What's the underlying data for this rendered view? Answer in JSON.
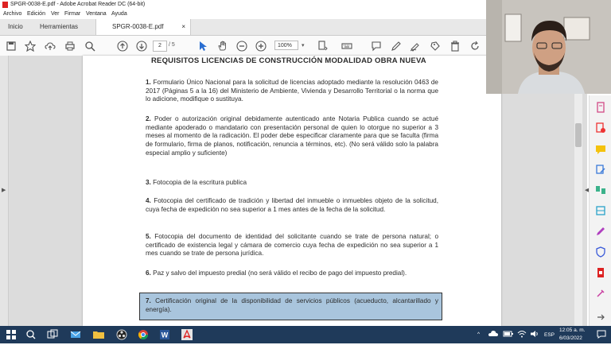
{
  "window": {
    "title": "SPGR-0038-E.pdf - Adobe Acrobat Reader DC (64-bit)"
  },
  "menu": [
    "Archivo",
    "Edición",
    "Ver",
    "Firmar",
    "Ventana",
    "Ayuda"
  ],
  "tabs": {
    "home": "Inicio",
    "tools": "Herramientas",
    "doc": "SPGR-0038-E.pdf",
    "close": "×"
  },
  "toolbar": {
    "page_current": "2",
    "page_total": "/ 5",
    "zoom": "100%",
    "zoom_caret": "▾"
  },
  "document": {
    "title": "REQUISITOS LICENCIAS DE CONSTRUCCIÓN MODALIDAD OBRA NUEVA",
    "items": [
      {
        "num": "1.",
        "text": "Formulario Único Nacional para la solicitud de licencias adoptado mediante la resolución 0463 de 2017 (Páginas 5 a la 16) del Ministerio de Ambiente, Vivienda y Desarrollo Territorial o la norma que lo adicione, modifique o sustituya."
      },
      {
        "num": "2.",
        "text": "Poder o autorización original debidamente autenticado ante Notaria Publica cuando se actué mediante apoderado o mandatario con presentación personal de quien lo otorgue no superior a 3 meses al momento de la radicación. El poder debe especificar claramente para que se faculta (firma de formulario, firma de planos, notificación, renuncia a términos, etc). (No será válido solo la palabra especial amplio y suficiente)"
      },
      {
        "num": "3.",
        "text": "Fotocopia de la escritura publica"
      },
      {
        "num": "4.",
        "text": "Fotocopia del certificado de tradición y libertad del inmueble o inmuebles objeto de la solicitud, cuya fecha de expedición no sea superior a 1 mes antes de la fecha de la solicitud."
      },
      {
        "num": "5.",
        "text": "Fotocopia del documento de identidad del solicitante cuando se trate de persona natural; o certificado de existencia legal y cámara de comercio cuya fecha de expedición no sea superior a 1 mes cuando se trate de persona jurídica."
      },
      {
        "num": "6.",
        "text": "Paz y salvo del impuesto predial (no será válido el recibo de pago del impuesto predial)."
      },
      {
        "num": "7.",
        "text": "Certificación original de la disponibilidad de servicios públicos (acueducto, alcantarillado y energía)."
      }
    ]
  },
  "tray": {
    "lang": "ESP",
    "time": "12:05 a. m.",
    "date": "6/03/2022",
    "chevron": "^"
  },
  "colors": {
    "highlight": "#a9c5dd",
    "taskbar": "#1f3a5a",
    "accent": "#d22"
  }
}
